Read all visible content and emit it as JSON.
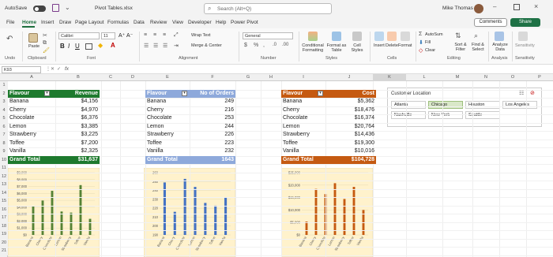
{
  "titlebar": {
    "autosave_label": "AutoSave",
    "toggle_state": "Off",
    "doc_title": "Pivot Tables.xlsx",
    "search_placeholder": "Search (Alt+Q)",
    "user_name": "Mike Thomas"
  },
  "tabs": [
    "File",
    "Home",
    "Insert",
    "Draw",
    "Page Layout",
    "Formulas",
    "Data",
    "Review",
    "View",
    "Developer",
    "Help",
    "Power Pivot"
  ],
  "active_tab": "Home",
  "comments_label": "Comments",
  "share_label": "Share",
  "ribbon": {
    "undo_group": "Undo",
    "paste_label": "Paste",
    "clipboard_group": "Clipboard",
    "font_name": "Calibri",
    "font_size": "11",
    "font_group": "Font",
    "wrap_text": "Wrap Text",
    "merge_center": "Merge & Center",
    "alignment_group": "Alignment",
    "number_format": "General",
    "number_group": "Number",
    "conditional_formatting": "Conditional Formatting",
    "format_as_table": "Format as Table",
    "cell_styles": "Cell Styles",
    "styles_group": "Styles",
    "insert_label": "Insert",
    "delete_label": "Delete",
    "format_label": "Format",
    "cells_group": "Cells",
    "autosum": "AutoSum",
    "fill": "Fill",
    "clear": "Clear",
    "sort_filter": "Sort & Filter",
    "find_select": "Find & Select",
    "editing_group": "Editing",
    "analyze_data": "Analyze Data",
    "analysis_group": "Analysis",
    "sensitivity": "Sensitivity",
    "sensitivity_group": "Sensitivity"
  },
  "formula_bar": {
    "name_box": "K93",
    "fx": "fx",
    "formula": ""
  },
  "columns": [
    "A",
    "B",
    "C",
    "D",
    "E",
    "F",
    "G",
    "H",
    "I",
    "J",
    "K",
    "L",
    "M",
    "N",
    "O",
    "P"
  ],
  "rows": [
    "1",
    "2",
    "3",
    "4",
    "5",
    "6",
    "7",
    "8",
    "9",
    "10",
    "11",
    "12",
    "13",
    "14",
    "15",
    "16",
    "17",
    "18",
    "19",
    "20",
    "21"
  ],
  "pivot_revenue": {
    "header_left": "Flavour",
    "header_right": "Revenue",
    "color": "#1e7a2e",
    "rows": [
      [
        "Banana",
        "$4,156"
      ],
      [
        "Cherry",
        "$4,970"
      ],
      [
        "Chocolate",
        "$6,376"
      ],
      [
        "Lemon",
        "$3,385"
      ],
      [
        "Strawberry",
        "$3,225"
      ],
      [
        "Toffee",
        "$7,200"
      ],
      [
        "Vanilla",
        "$2,325"
      ]
    ],
    "total_label": "Grand Total",
    "total_value": "$31,637"
  },
  "pivot_orders": {
    "header_left": "Flavour",
    "header_right": "No of Orders",
    "color": "#8ea9db",
    "rows": [
      [
        "Banana",
        "249"
      ],
      [
        "Cherry",
        "216"
      ],
      [
        "Chocolate",
        "253"
      ],
      [
        "Lemon",
        "244"
      ],
      [
        "Strawberry",
        "226"
      ],
      [
        "Toffee",
        "223"
      ],
      [
        "Vanilla",
        "232"
      ]
    ],
    "total_label": "Grand Total",
    "total_value": "1643"
  },
  "pivot_cost": {
    "header_left": "Flavour",
    "header_right": "Cost",
    "color": "#c55a11",
    "rows": [
      [
        "Banana",
        "$5,362"
      ],
      [
        "Cherry",
        "$18,476"
      ],
      [
        "Chocolate",
        "$16,374"
      ],
      [
        "Lemon",
        "$20,764"
      ],
      [
        "Strawberry",
        "$14,436"
      ],
      [
        "Toffee",
        "$19,300"
      ],
      [
        "Vanilla",
        "$10,016"
      ]
    ],
    "total_label": "Grand Total",
    "total_value": "$104,728"
  },
  "slicer": {
    "title": "Customer Location",
    "items": [
      "Atlanta",
      "Chicago",
      "Houston",
      "Los Angeles",
      "Nashville",
      "New York",
      "Seattle"
    ],
    "selected": "Chicago"
  },
  "chart_data": [
    {
      "type": "bar",
      "categories": [
        "Banana",
        "Cherry",
        "Chocolate",
        "Lemon",
        "Strawberry",
        "Toffee",
        "Vanilla"
      ],
      "values": [
        4156,
        4970,
        6376,
        3385,
        3225,
        7200,
        2325
      ],
      "ylim": [
        0,
        9000
      ],
      "yticks": [
        "$0",
        "$1,000",
        "$2,000",
        "$3,000",
        "$4,000",
        "$5,000",
        "$6,000",
        "$7,000",
        "$8,000",
        "$9,000"
      ],
      "color": "#548235",
      "background": "#fff2cc"
    },
    {
      "type": "bar",
      "categories": [
        "Banana",
        "Cherry",
        "Chocolate",
        "Lemon",
        "Strawberry",
        "Toffee",
        "Vanilla"
      ],
      "values": [
        249,
        216,
        253,
        244,
        226,
        223,
        232
      ],
      "ylim": [
        190,
        260
      ],
      "yticks": [
        "190",
        "200",
        "210",
        "220",
        "230",
        "240",
        "250",
        "260"
      ],
      "color": "#4472c4",
      "background": "#fff2cc"
    },
    {
      "type": "bar",
      "categories": [
        "Banana",
        "Cherry",
        "Chocolate",
        "Lemon",
        "Strawberry",
        "Toffee",
        "Vanilla"
      ],
      "values": [
        5362,
        18476,
        16374,
        20764,
        14436,
        19300,
        10016
      ],
      "ylim": [
        0,
        25000
      ],
      "yticks": [
        "$0",
        "$5,000",
        "$10,000",
        "$15,000",
        "$20,000",
        "$25,000"
      ],
      "color": "#c55a11",
      "background": "#fff2cc"
    }
  ]
}
